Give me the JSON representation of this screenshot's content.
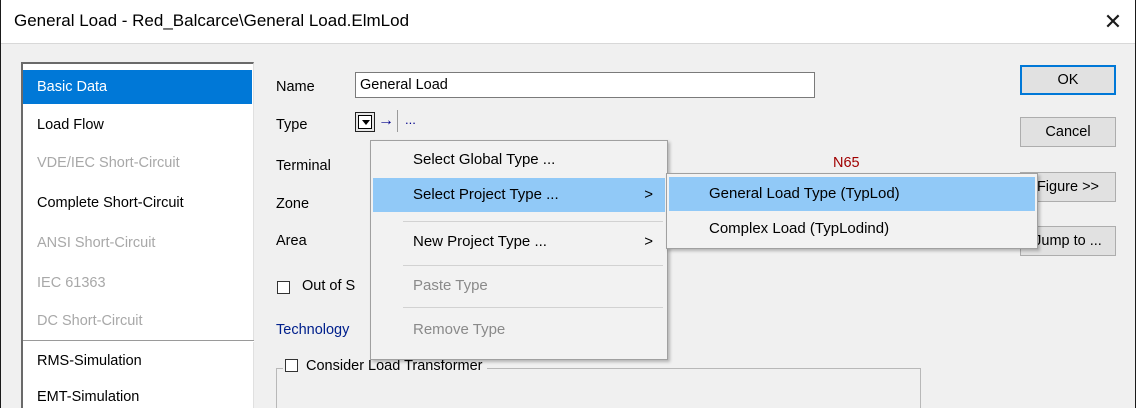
{
  "window": {
    "title": "General Load - Red_Balcarce\\General Load.ElmLod",
    "close_glyph": "✕"
  },
  "sidebar": {
    "items": [
      {
        "label": "Basic Data",
        "state": "selected"
      },
      {
        "label": "Load Flow",
        "state": "normal"
      },
      {
        "label": "VDE/IEC Short-Circuit",
        "state": "disabled"
      },
      {
        "label": "Complete Short-Circuit",
        "state": "normal"
      },
      {
        "label": "ANSI Short-Circuit",
        "state": "disabled"
      },
      {
        "label": "IEC 61363",
        "state": "disabled"
      },
      {
        "label": "DC Short-Circuit",
        "state": "disabled"
      },
      {
        "label": "RMS-Simulation",
        "state": "normal"
      },
      {
        "label": "EMT-Simulation",
        "state": "normal"
      }
    ]
  },
  "form": {
    "name_label": "Name",
    "name_value": "General Load",
    "type_label": "Type",
    "type_ellipsis": "...",
    "type_arrow": "→",
    "terminal_label": "Terminal",
    "terminal_value": "N65",
    "zone_label": "Zone",
    "area_label": "Area",
    "out_of_service_label": "Out of S",
    "technology_label": "Technology",
    "consider_transformer_label": "Consider Load Transformer"
  },
  "buttons": {
    "ok": "OK",
    "cancel": "Cancel",
    "figure": "Figure >>",
    "jump_to": "Jump to ..."
  },
  "context_menu": {
    "items": [
      {
        "label": "Select Global Type ...",
        "state": "normal",
        "submenu": false
      },
      {
        "label": "Select Project Type ...",
        "state": "hover",
        "submenu": true
      },
      {
        "label": "New Project Type ...",
        "state": "normal",
        "submenu": true
      },
      {
        "label": "Paste Type",
        "state": "disabled",
        "submenu": false
      },
      {
        "label": "Remove Type",
        "state": "disabled",
        "submenu": false
      }
    ],
    "submenu_arrow": ">"
  },
  "submenu": {
    "items": [
      {
        "label": "General Load Type (TypLod)",
        "state": "hover"
      },
      {
        "label": "Complex Load (TypLodind)",
        "state": "normal"
      }
    ]
  },
  "colors": {
    "selection": "#0078d7",
    "menu_hover": "#91c9f7",
    "terminal_value": "#a00000",
    "link": "#00208c"
  }
}
